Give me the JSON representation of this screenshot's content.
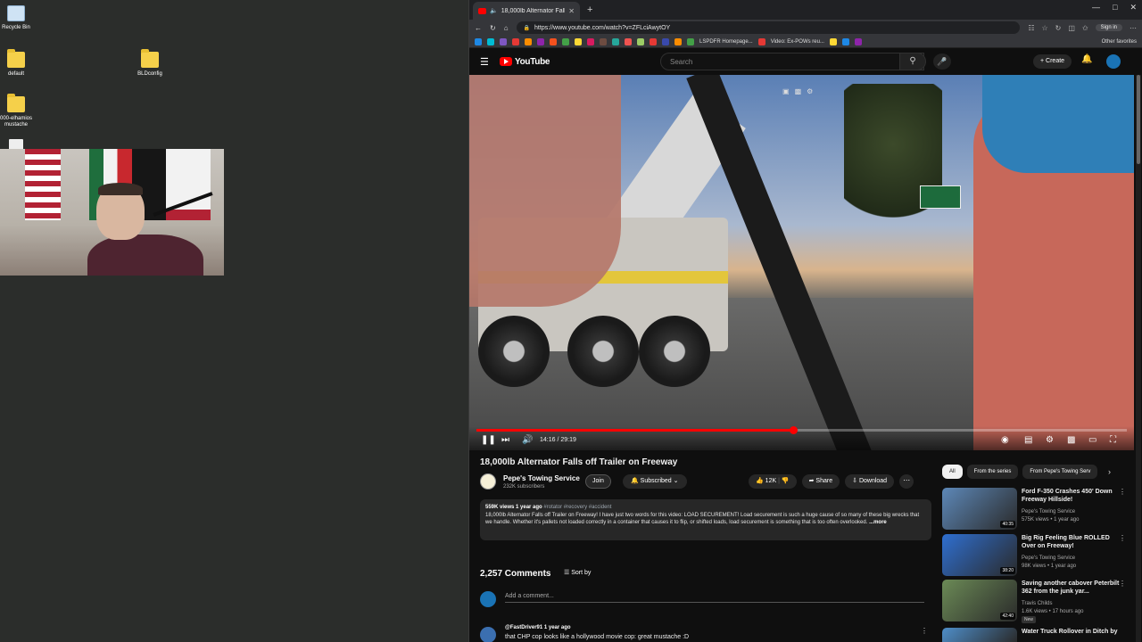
{
  "desktop": {
    "icons": [
      {
        "label": "Recycle Bin",
        "kind": "bin"
      },
      {
        "label": "default",
        "kind": "folder"
      },
      {
        "label": "BLDconfig",
        "kind": "folder"
      },
      {
        "label": "000-elhamios mustache",
        "kind": "folder"
      }
    ]
  },
  "browser": {
    "tab_title": "18,000lb Alternator Falls off",
    "url": "https://www.youtube.com/watch?v=ZFLciAwytOY",
    "sign_in": "Sign in",
    "bookmarks": [
      "LSPDFR Homepage...",
      "Video: Ex-POWs reu...",
      "Other favorites"
    ]
  },
  "youtube": {
    "logo": "YouTube",
    "search_placeholder": "Search",
    "create_label": "Create",
    "player": {
      "time": "14:16 / 29:19",
      "progress": 0.487
    },
    "video_title": "18,000lb Alternator Falls off Trailer on Freeway",
    "channel": {
      "name": "Pepe's Towing Service",
      "subscribers": "232K subscribers",
      "join": "Join",
      "subscribed": "Subscribed"
    },
    "actions": {
      "likes": "12K",
      "share": "Share",
      "download": "Download"
    },
    "description": {
      "meta": "559K views  1 year ago",
      "tags": "#rotator #recovery #accident",
      "text": "18,000lb Alternator Falls off Trailer on Freeway! I have just two words for this video: LOAD SECUREMENT! Load securement is such a huge cause of so many of these big wrecks that we handle. Whether it's pallets not loaded correctly in a container that causes it to flip, or shifted loads, load securement is something that is too often overlooked.",
      "more": "...more"
    },
    "comments": {
      "count": "2,257 Comments",
      "sort": "Sort by",
      "add_placeholder": "Add a comment...",
      "first_author": "@FastDriver91  1 year ago",
      "first_text": "that CHP cop looks like a hollywood movie cop: great mustache :D"
    },
    "chips": [
      "All",
      "From the series",
      "From Pepe's Towing Serv"
    ],
    "recommendations": [
      {
        "title": "Ford F-350 Crashes 450' Down Freeway Hillside!",
        "channel": "Pepe's Towing Service",
        "meta": "575K views • 1 year ago",
        "duration": "40:35",
        "thumb": "#5d88b8"
      },
      {
        "title": "Big Rig Feeling Blue ROLLED Over on Freeway!",
        "channel": "Pepe's Towing Service",
        "meta": "98K views • 1 year ago",
        "duration": "38:20",
        "thumb": "#2f6fd0"
      },
      {
        "title": "Saving another cabover Peterbilt 362 from the junk yar...",
        "channel": "Travis Childs",
        "meta": "1.6K views • 17 hours ago",
        "duration": "42:40",
        "thumb": "#6b8a56",
        "badge": "New"
      },
      {
        "title": "Water Truck Rollover in Ditch by",
        "channel": "",
        "meta": "",
        "duration": "",
        "thumb": "#4e8ec9"
      }
    ]
  }
}
